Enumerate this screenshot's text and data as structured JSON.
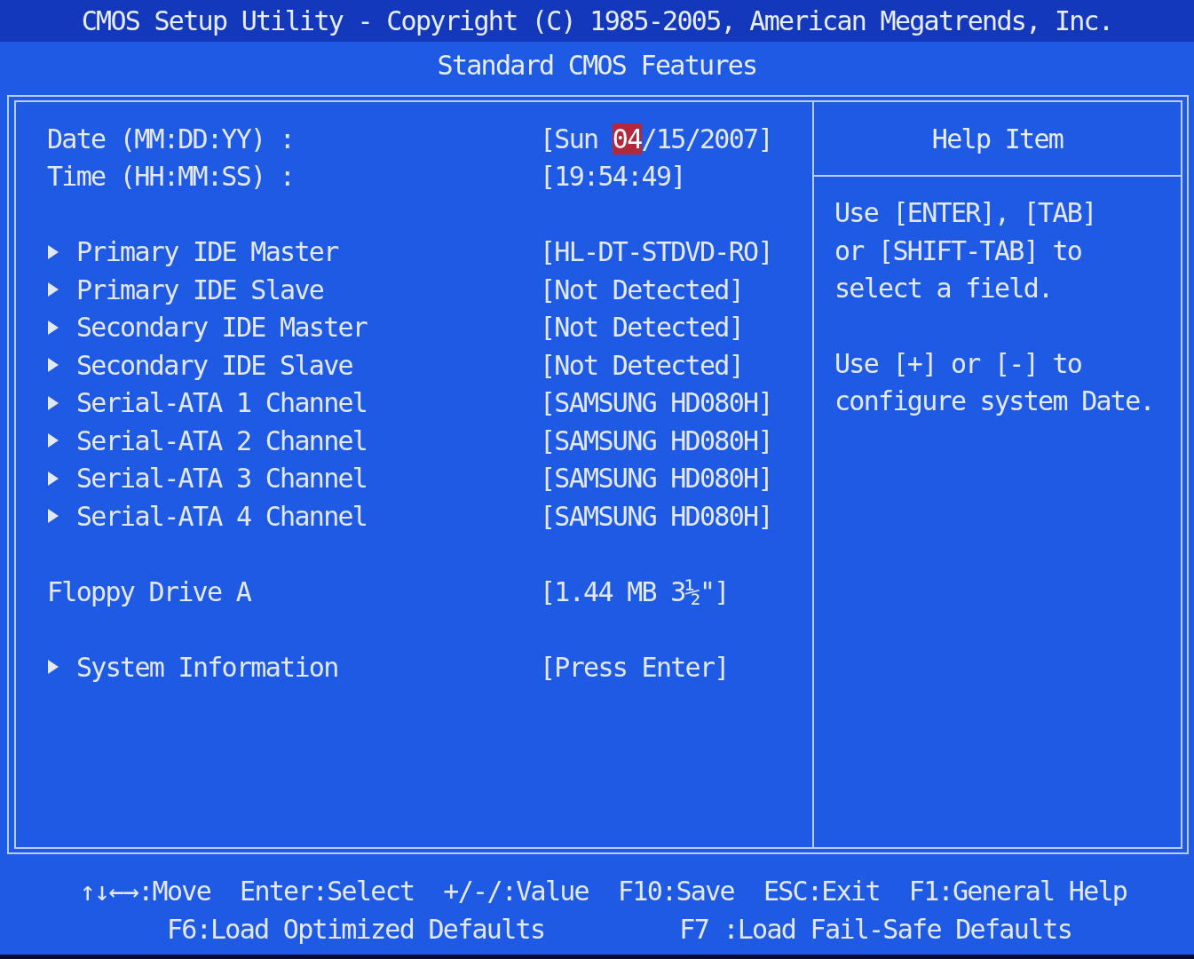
{
  "header": {
    "title": "CMOS Setup Utility - Copyright (C) 1985-2005, American Megatrends, Inc.",
    "subtitle": "Standard CMOS Features"
  },
  "settings": {
    "groups": [
      {
        "items": [
          {
            "kind": "setting",
            "label": "Date (MM:DD:YY) :",
            "value_parts": [
              {
                "text": "[Sun ",
                "selected": false
              },
              {
                "text": "04",
                "selected": true
              },
              {
                "text": "/15/2007]",
                "selected": false
              }
            ]
          },
          {
            "kind": "setting",
            "label": "Time (HH:MM:SS) :",
            "value_parts": [
              {
                "text": "[19:54:49]",
                "selected": false
              }
            ]
          }
        ]
      },
      {
        "items": [
          {
            "kind": "submenu",
            "label": "Primary IDE Master",
            "value": "[HL-DT-STDVD-RO]"
          },
          {
            "kind": "submenu",
            "label": "Primary IDE Slave",
            "value": "[Not Detected]"
          },
          {
            "kind": "submenu",
            "label": "Secondary IDE Master",
            "value": "[Not Detected]"
          },
          {
            "kind": "submenu",
            "label": "Secondary IDE Slave",
            "value": "[Not Detected]"
          },
          {
            "kind": "submenu",
            "label": "Serial-ATA 1 Channel",
            "value": "[SAMSUNG HD080H]"
          },
          {
            "kind": "submenu",
            "label": "Serial-ATA 2 Channel",
            "value": "[SAMSUNG HD080H]"
          },
          {
            "kind": "submenu",
            "label": "Serial-ATA 3 Channel",
            "value": "[SAMSUNG HD080H]"
          },
          {
            "kind": "submenu",
            "label": "Serial-ATA 4 Channel",
            "value": "[SAMSUNG HD080H]"
          }
        ]
      },
      {
        "items": [
          {
            "kind": "setting",
            "label": "Floppy Drive A",
            "value": "[1.44 MB 3½\"]"
          }
        ]
      },
      {
        "items": [
          {
            "kind": "submenu",
            "label": "System Information",
            "value": "[Press Enter]"
          }
        ]
      }
    ]
  },
  "help": {
    "title": "Help Item",
    "paragraphs": [
      "Use [ENTER], [TAB]\nor [SHIFT-TAB] to\nselect a field.",
      "Use [+] or [-] to\nconfigure system Date."
    ]
  },
  "footer": {
    "lines": [
      [
        "↑↓←→:Move",
        "Enter:Select",
        "+/-/:Value",
        "F10:Save",
        "ESC:Exit",
        "F1:General Help"
      ],
      [
        "F6:Load Optimized Defaults",
        "F7 :Load Fail-Safe Defaults"
      ]
    ]
  }
}
